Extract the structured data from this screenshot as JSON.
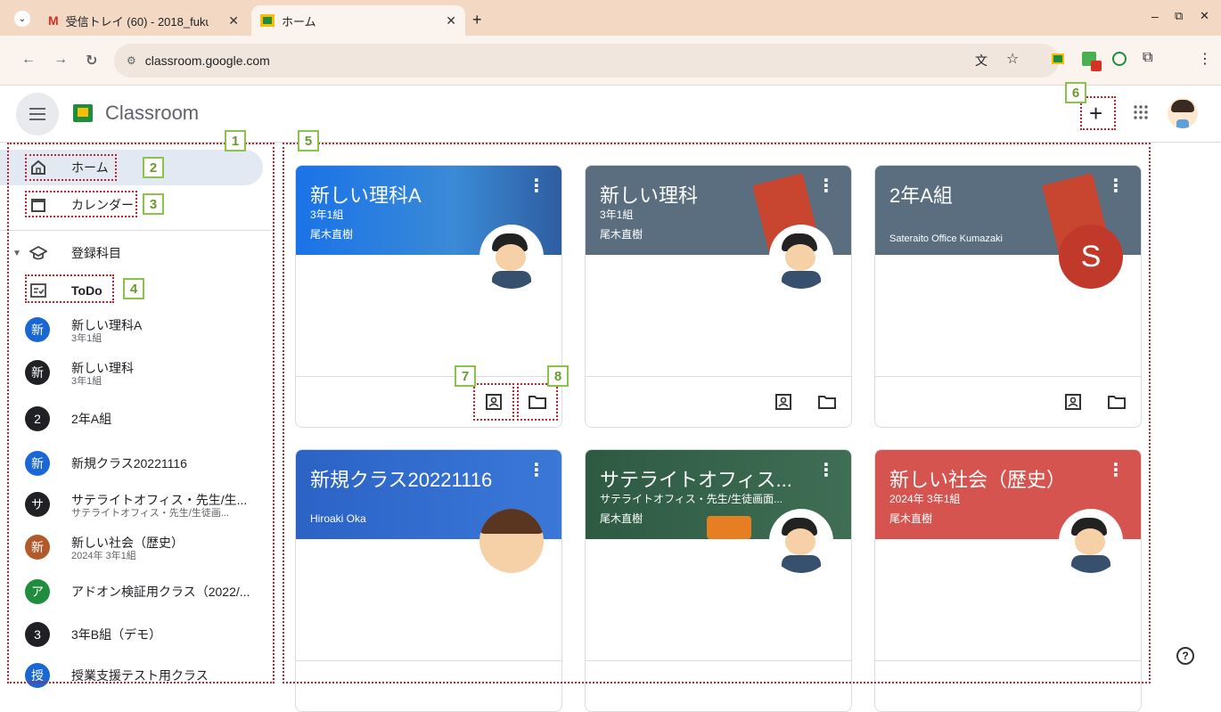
{
  "browser": {
    "tabs": [
      {
        "label": "受信トレイ (60) - 2018_fukuc",
        "icon": "gmail-icon"
      },
      {
        "label": "ホーム",
        "icon": "classroom-icon"
      }
    ],
    "new_tab": "+",
    "url": "classroom.google.com",
    "window_controls": {
      "minimize": "–",
      "restore": "⧉",
      "close": "✕"
    }
  },
  "app": {
    "title": "Classroom",
    "create_button": "+",
    "help": "?"
  },
  "sidebar": {
    "home": "ホーム",
    "calendar": "カレンダー",
    "enrolled": "登録科目",
    "todo": "ToDo",
    "courses": [
      {
        "initial": "新",
        "name": "新しい理科A",
        "section": "3年1組",
        "color": "#1967d2"
      },
      {
        "initial": "新",
        "name": "新しい理科",
        "section": "3年1組",
        "color": "#202124"
      },
      {
        "initial": "2",
        "name": "2年A組",
        "section": "",
        "color": "#202124"
      },
      {
        "initial": "新",
        "name": "新規クラス20221116",
        "section": "",
        "color": "#1967d2"
      },
      {
        "initial": "サ",
        "name": "サテライトオフィス・先生/生...",
        "section": "サテライトオフィス・先生/生徒画...",
        "color": "#202124"
      },
      {
        "initial": "新",
        "name": "新しい社会（歴史）",
        "section": "2024年 3年1組",
        "color": "#b35a2c"
      },
      {
        "initial": "ア",
        "name": "アドオン検証用クラス（2022/...",
        "section": "",
        "color": "#1e8e3e"
      },
      {
        "initial": "3",
        "name": "3年B組（デモ）",
        "section": "",
        "color": "#202124"
      },
      {
        "initial": "授",
        "name": "授業支援テスト用クラス",
        "section": "",
        "color": "#1967d2"
      }
    ]
  },
  "cards": [
    {
      "title": "新しい理科A",
      "section": "3年1組",
      "teacher": "尾木直樹",
      "color": "#1a73e8",
      "photo": "teacher"
    },
    {
      "title": "新しい理科",
      "section": "3年1組",
      "teacher": "尾木直樹",
      "color": "#5a6e80",
      "photo": "teacher"
    },
    {
      "title": "2年A組",
      "section": "",
      "teacher": "Sateraito Office Kumazaki",
      "color": "#5a6e80",
      "photo": "S"
    },
    {
      "title": "新規クラス20221116",
      "section": "",
      "teacher": "Hiroaki Oka",
      "color": "#2b63c5",
      "photo": "boy"
    },
    {
      "title": "サテライトオフィス...",
      "section": "サテライトオフィス・先生/生徒画面...",
      "teacher": "尾木直樹",
      "color": "#2e5a42",
      "photo": "teacher"
    },
    {
      "title": "新しい社会（歴史）",
      "section": "2024年 3年1組",
      "teacher": "尾木直樹",
      "color": "#d6544f",
      "photo": "teacher"
    }
  ],
  "annotations": [
    "1",
    "2",
    "3",
    "4",
    "5",
    "6",
    "7",
    "8"
  ]
}
